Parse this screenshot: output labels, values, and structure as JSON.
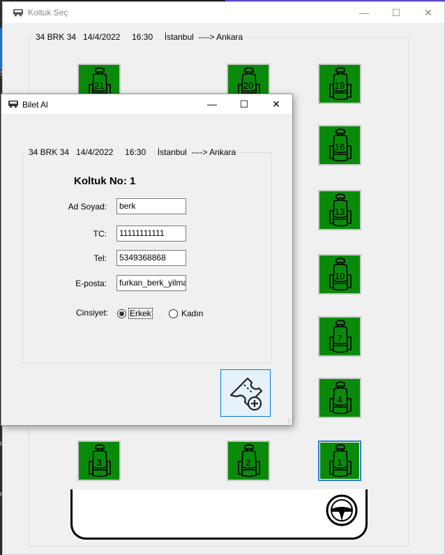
{
  "main_window": {
    "title": "Koltuk Seç",
    "trip_info": "34 BRK 34   14/4/2022     16:30     İstanbul  ----> Ankara",
    "seats": [
      {
        "number": "21",
        "selected": false
      },
      {
        "number": "20",
        "selected": false
      },
      {
        "number": "19",
        "selected": false
      },
      {
        "number": "16",
        "selected": false
      },
      {
        "number": "13",
        "selected": false
      },
      {
        "number": "10",
        "selected": false
      },
      {
        "number": "7",
        "selected": false
      },
      {
        "number": "4",
        "selected": false
      },
      {
        "number": "3",
        "selected": false
      },
      {
        "number": "2",
        "selected": false
      },
      {
        "number": "1",
        "selected": true
      }
    ],
    "seat_color": "#0a8a0a",
    "controls": {
      "minimize": "—",
      "maximize": "☐",
      "close": "✕"
    }
  },
  "dialog": {
    "title": "Bilet Al",
    "trip_info": "34 BRK 34   14/4/2022     16:30     İstanbul  ----> Ankara",
    "heading": "Koltuk No: 1",
    "fields": {
      "name_label": "Ad Soyad:",
      "name_value": "berk",
      "tc_label": "TC:",
      "tc_value": "11111111111",
      "tel_label": "Tel:",
      "tel_value": "5349368868",
      "email_label": "E-posta:",
      "email_value": "furkan_berk_yilma"
    },
    "gender": {
      "label": "Cinsiyet:",
      "options": [
        "Erkek",
        "Kadın"
      ],
      "selected": "Erkek"
    },
    "buy_button_icon": "ticket-add-icon",
    "controls": {
      "minimize": "—",
      "maximize": "☐",
      "close": "✕"
    }
  },
  "background": {
    "fragments": [
      "S",
      "du",
      "ra"
    ]
  }
}
